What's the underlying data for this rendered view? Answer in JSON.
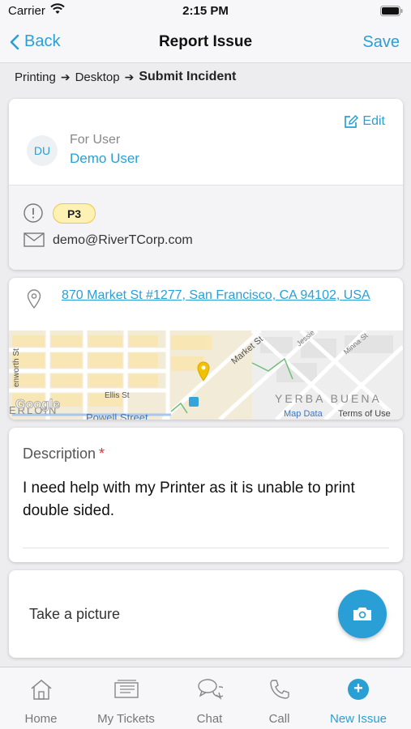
{
  "status_bar": {
    "carrier": "Carrier",
    "time": "2:15 PM"
  },
  "nav": {
    "back_label": "Back",
    "title": "Report Issue",
    "save_label": "Save"
  },
  "breadcrumb": {
    "items": [
      "Printing",
      "Desktop"
    ],
    "current": "Submit Incident"
  },
  "user_card": {
    "edit_label": "Edit",
    "avatar_initials": "DU",
    "for_user_label": "For User",
    "for_user_name": "Demo User",
    "priority": "P3",
    "email": "demo@RiverTCorp.com"
  },
  "location": {
    "address": "870 Market St #1277, San Francisco, CA 94102, USA",
    "map_labels": {
      "market_st": "Market St",
      "jessie": "Jessie",
      "minna_st": "Minna St",
      "ellis_st": "Ellis St",
      "powell_street": "Powell Street",
      "leavenworth": "enworth St",
      "yerba_buena": "YERBA BUENA",
      "tenderloin": "ERLOIN",
      "google": "Google",
      "map_data": "Map Data",
      "terms": "Terms of Use"
    }
  },
  "description": {
    "label": "Description",
    "required_mark": "*",
    "text": "I need help with my Printer as it is unable to print double sided."
  },
  "picture": {
    "label": "Take a picture"
  },
  "tabs": [
    {
      "label": "Home",
      "icon": "home-icon"
    },
    {
      "label": "My Tickets",
      "icon": "tickets-icon"
    },
    {
      "label": "Chat",
      "icon": "chat-icon"
    },
    {
      "label": "Call",
      "icon": "phone-icon"
    },
    {
      "label": "New Issue",
      "icon": "plus-circle-icon",
      "active": true
    }
  ],
  "colors": {
    "accent": "#2a9fd6",
    "priority_bg": "#fdf2b3",
    "required": "#e0303a",
    "map_pin": "#f2c200"
  }
}
